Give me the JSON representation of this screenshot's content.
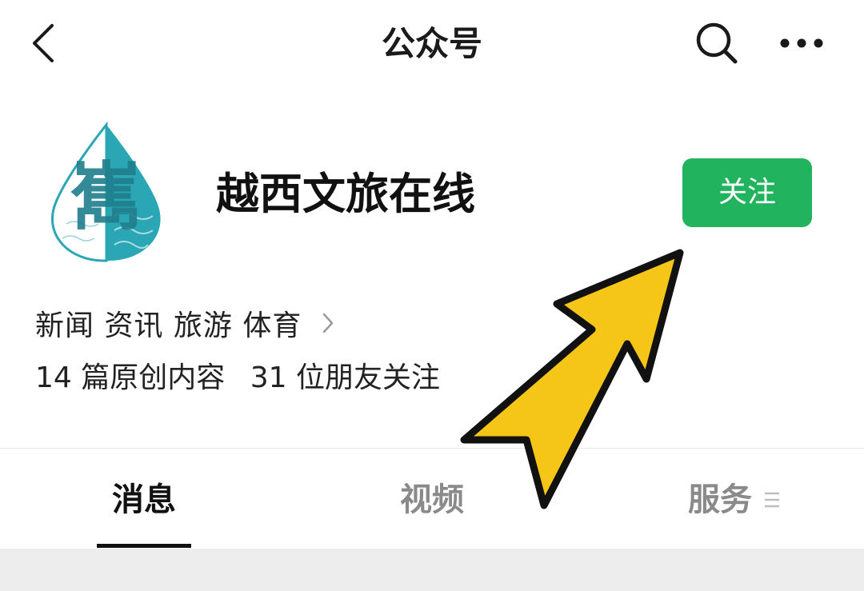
{
  "topbar": {
    "title": "公众号",
    "back_icon": "chevron-left-icon",
    "search_icon": "search-icon",
    "more_icon": "more-horizontal-icon"
  },
  "profile": {
    "name": "越西文旅在线",
    "follow_label": "关注",
    "avatar_logo_text": "嶲",
    "category": "新闻 资讯 旅游 体育",
    "stats": {
      "original": "14 篇原创内容",
      "friends": "31 位朋友关注"
    }
  },
  "tabs": [
    {
      "label": "消息",
      "active": true
    },
    {
      "label": "视频",
      "active": false
    },
    {
      "label": "服务",
      "active": false
    }
  ],
  "colors": {
    "follow_button": "#22b35e",
    "logo_teal": "#2aa6b4",
    "arrow_fill": "#f5c518",
    "arrow_outline": "#111111",
    "bottom_band": "#ededed"
  }
}
